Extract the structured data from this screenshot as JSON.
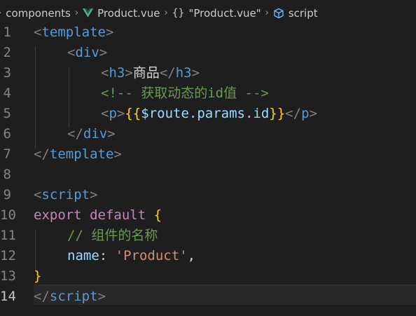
{
  "breadcrumb": {
    "items": [
      "components",
      "Product.vue",
      "\"Product.vue\"",
      "script"
    ],
    "braces_glyph": "{}",
    "icons": [
      "vue-icon",
      "braces-icon",
      "cube-icon"
    ]
  },
  "editor": {
    "line_numbers": [
      "1",
      "2",
      "3",
      "4",
      "5",
      "6",
      "7",
      "8",
      "9",
      "10",
      "11",
      "12",
      "13",
      "14"
    ],
    "active_line": "14",
    "lines": {
      "l1": {
        "lt": "<",
        "tag": "template",
        "gt": ">"
      },
      "l2": {
        "lt": "<",
        "tag": "div",
        "gt": ">"
      },
      "l3": {
        "lt1": "<",
        "tag1": "h3",
        "gt1": ">",
        "text": "商品",
        "lt2": "</",
        "tag2": "h3",
        "gt2": ">"
      },
      "l4": {
        "comment": "<!-- 获取动态的id值 -->"
      },
      "l5": {
        "lt1": "<",
        "tag1": "p",
        "gt1": ">",
        "open": "{{",
        "expr": "$route.params.id",
        "close": "}}",
        "lt2": "</",
        "tag2": "p",
        "gt2": ">"
      },
      "l6": {
        "lt": "</",
        "tag": "div",
        "gt": ">"
      },
      "l7": {
        "lt": "</",
        "tag": "template",
        "gt": ">"
      },
      "l9": {
        "lt": "<",
        "tag": "script",
        "gt": ">"
      },
      "l10": {
        "kw1": "export",
        "kw2": "default",
        "brace": "{"
      },
      "l11": {
        "comment": "// 组件的名称"
      },
      "l12": {
        "key": "name",
        "colon": ": ",
        "value": "'Product'",
        "comma": ","
      },
      "l13": {
        "brace": "}"
      },
      "l14": {
        "lt": "</",
        "tag": "script",
        "gt": ">"
      }
    }
  },
  "colors": {
    "background": "#1e1e1e",
    "tag": "#569cd6",
    "punctuation": "#808080",
    "comment": "#6a9955",
    "brace": "#ffd700",
    "variable": "#9cdcfe",
    "keyword": "#c586c0",
    "string": "#ce9178",
    "vue_green": "#41b883"
  }
}
